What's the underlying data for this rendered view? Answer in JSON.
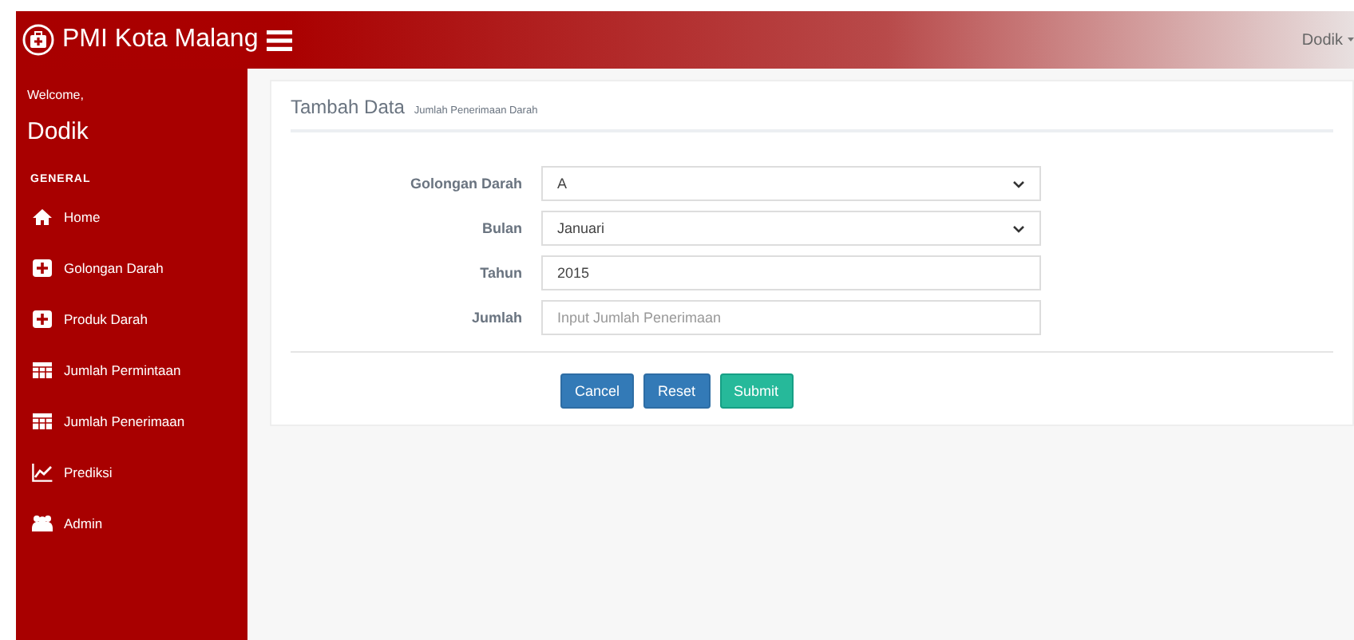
{
  "brand": {
    "title": "PMI Kota Malang"
  },
  "user_menu": {
    "label": "Dodik"
  },
  "sidebar": {
    "welcome": "Welcome,",
    "user": "Dodik",
    "section": "GENERAL",
    "items": [
      {
        "label": "Home"
      },
      {
        "label": "Golongan Darah"
      },
      {
        "label": "Produk Darah"
      },
      {
        "label": "Jumlah Permintaan"
      },
      {
        "label": "Jumlah Penerimaan"
      },
      {
        "label": "Prediksi"
      },
      {
        "label": "Admin"
      }
    ]
  },
  "panel": {
    "title": "Tambah Data",
    "subtitle": "Jumlah Penerimaan Darah"
  },
  "form": {
    "fields": [
      {
        "label": "Golongan Darah",
        "kind": "select",
        "value": "A"
      },
      {
        "label": "Bulan",
        "kind": "select",
        "value": "Januari"
      },
      {
        "label": "Tahun",
        "kind": "input",
        "value": "2015"
      },
      {
        "label": "Jumlah",
        "kind": "input",
        "placeholder": "Input Jumlah Penerimaan"
      }
    ]
  },
  "buttons": [
    {
      "label": "Cancel",
      "kind": "primary"
    },
    {
      "label": "Reset",
      "kind": "primary"
    },
    {
      "label": "Submit",
      "kind": "success"
    }
  ]
}
